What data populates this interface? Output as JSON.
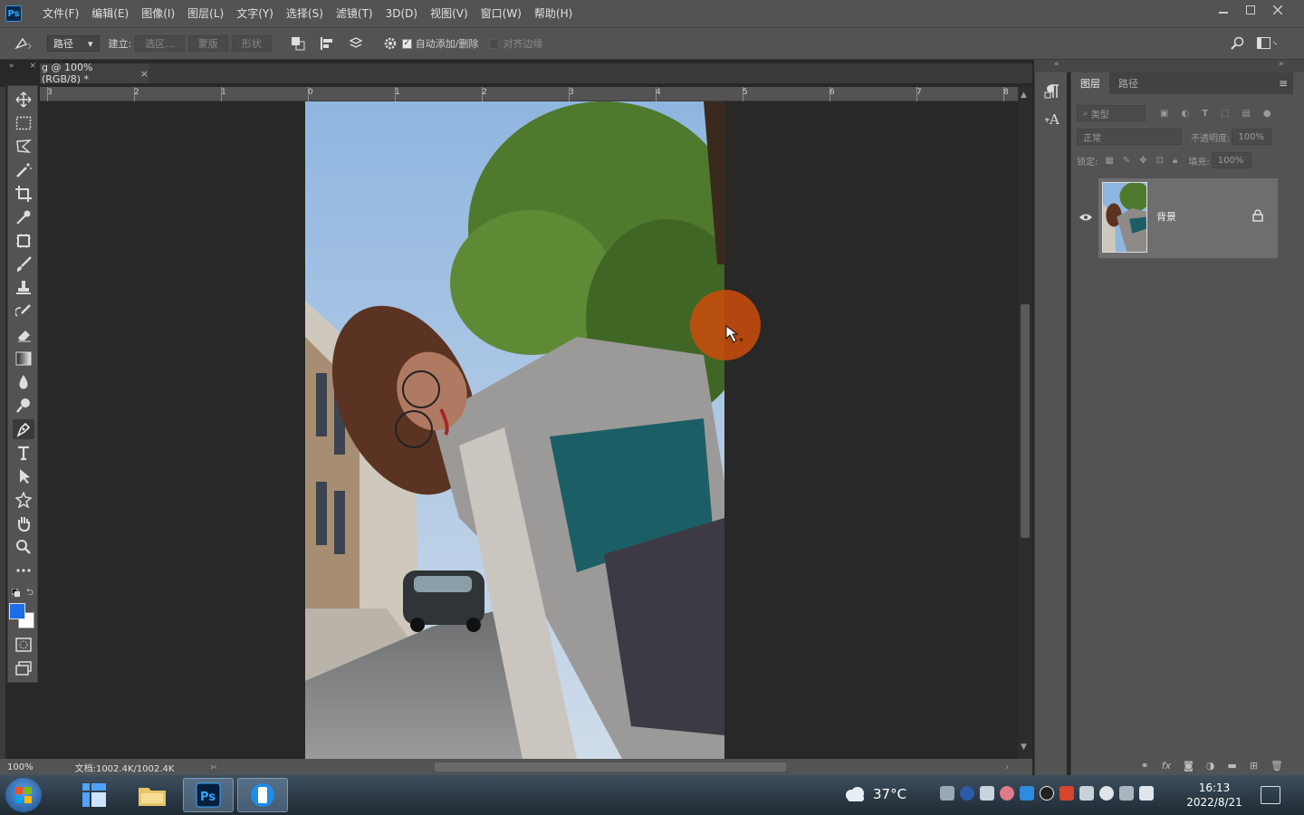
{
  "app": {
    "logo": "Ps"
  },
  "menu": [
    "文件(F)",
    "编辑(E)",
    "图像(I)",
    "图层(L)",
    "文字(Y)",
    "选择(S)",
    "滤镜(T)",
    "3D(D)",
    "视图(V)",
    "窗口(W)",
    "帮助(H)"
  ],
  "options": {
    "mode_value": "路径",
    "make_label": "建立:",
    "selection_btn": "选区...",
    "mask_btn": "蒙版",
    "shape_btn": "形状",
    "auto_add_label": "自动添加/删除",
    "align_edges_label": "对齐边缘"
  },
  "document": {
    "tab_title": "g @ 100%(RGB/8) *",
    "tab_close": "×",
    "zoom": "100%",
    "doc_info": "文档:1002.4K/1002.4K"
  },
  "ruler_labels": [
    "3",
    "2",
    "1",
    "0",
    "1",
    "2",
    "3",
    "4",
    "5",
    "6",
    "7",
    "8"
  ],
  "layers_panel": {
    "tabs": [
      "图层",
      "路径"
    ],
    "filter_placeholder": "类型",
    "blend_mode": "正常",
    "opacity_label": "不透明度:",
    "opacity_value": "100%",
    "lock_label": "锁定:",
    "fill_label": "填充:",
    "fill_value": "100%",
    "layer_name": "背景",
    "footer_icons": [
      "link-icon",
      "fx-icon",
      "mask-icon",
      "adjustment-icon",
      "folder-icon",
      "new-layer-icon",
      "trash-icon"
    ]
  },
  "colors": {
    "foreground": "#1a6ee8",
    "background": "#ffffff",
    "accent": "#31a8ff"
  },
  "taskbar": {
    "temperature": "37°C",
    "time": "16:13",
    "date": "2022/8/21"
  }
}
